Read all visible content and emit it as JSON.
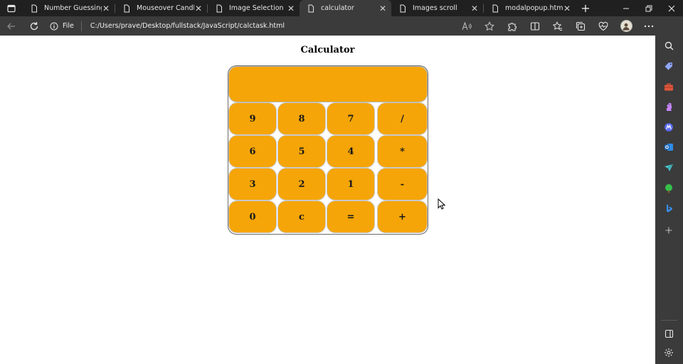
{
  "browser": {
    "tabs": [
      {
        "title": "Number Guessing Gam",
        "active": false
      },
      {
        "title": "Mouseover Candle",
        "active": false
      },
      {
        "title": "Image Selection",
        "active": false
      },
      {
        "title": "calculator",
        "active": true
      },
      {
        "title": "Images scroll",
        "active": false
      },
      {
        "title": "modalpopup.html",
        "active": false
      }
    ],
    "address": {
      "scheme_label": "File",
      "url": "C:/Users/prave/Desktop/fullstack/JavaScript/calctask.html"
    }
  },
  "page": {
    "title": "Calculator",
    "display_value": "",
    "keys": [
      [
        "9",
        "8",
        "7",
        "/"
      ],
      [
        "6",
        "5",
        "4",
        "*"
      ],
      [
        "3",
        "2",
        "1",
        "-"
      ],
      [
        "0",
        "c",
        "=",
        "+"
      ]
    ],
    "accent_color": "#f5a507"
  }
}
